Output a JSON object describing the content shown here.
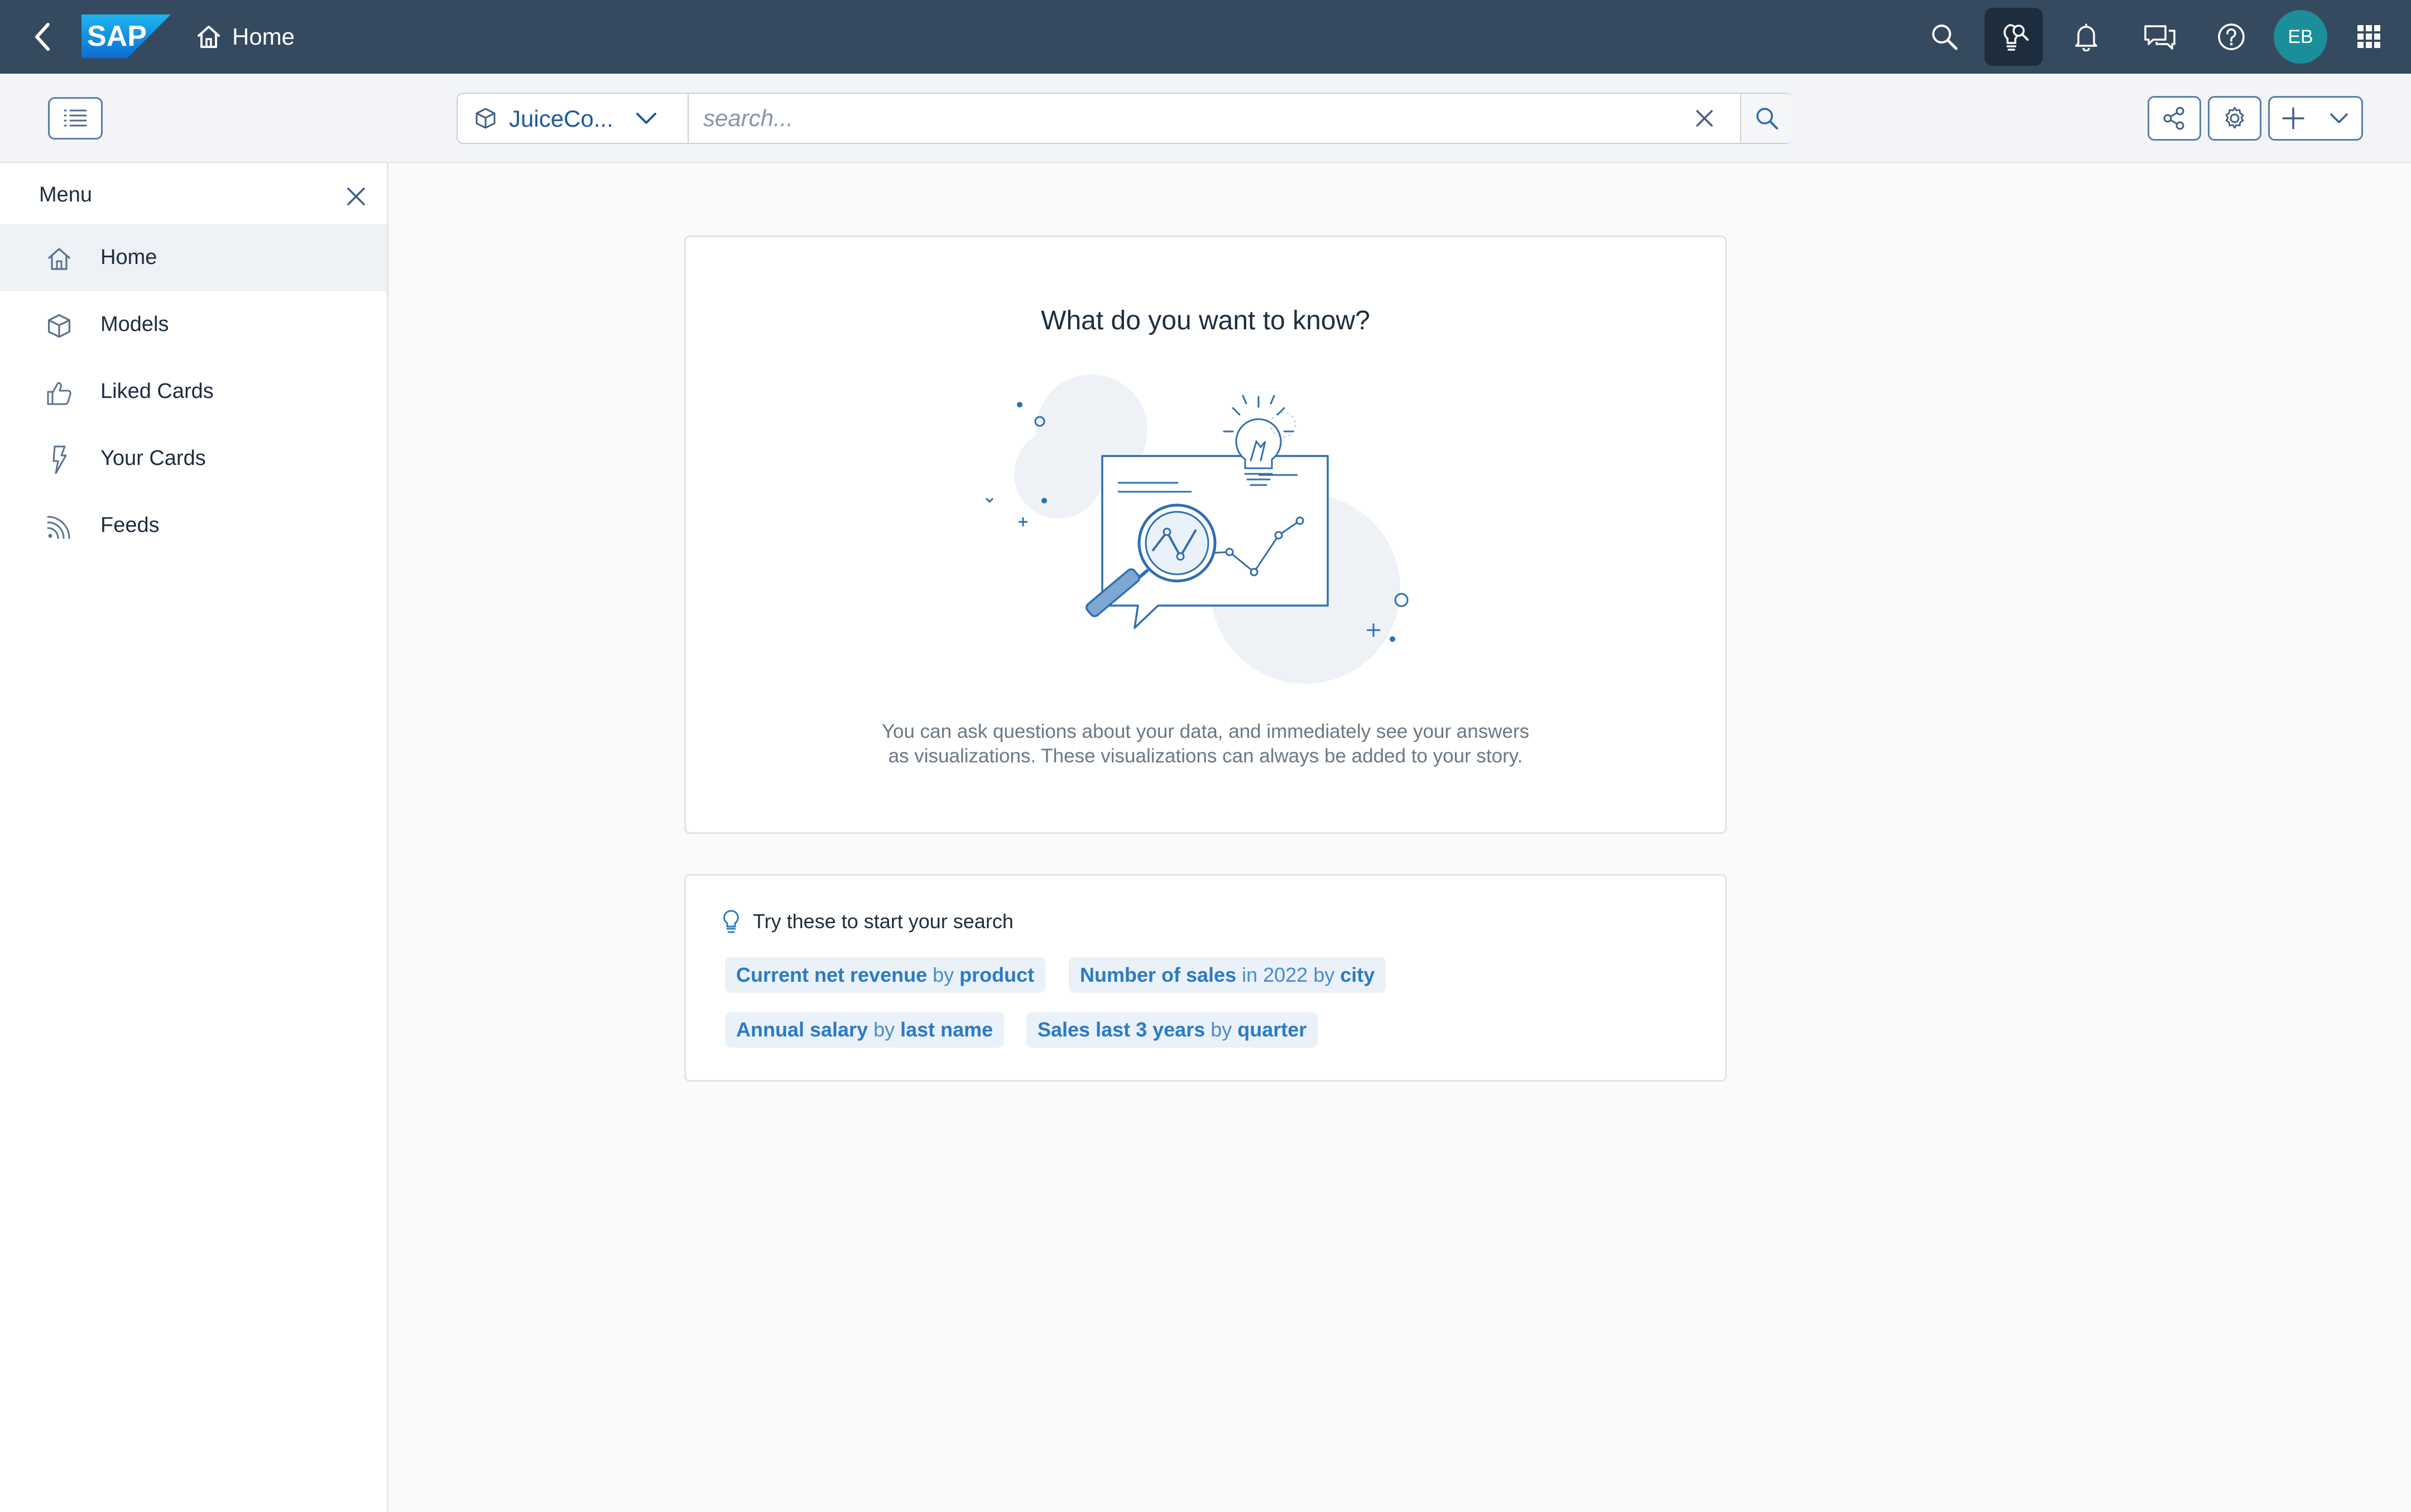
{
  "shellbar": {
    "logo_text": "SAP",
    "home_label": "Home",
    "avatar_initials": "EB",
    "icons": [
      "back-icon",
      "home-icon",
      "search-icon",
      "insight-icon",
      "bell-icon",
      "chat-icon",
      "help-icon",
      "app-grid-icon"
    ]
  },
  "toolbar": {
    "model_name": "JuiceCo...",
    "search_placeholder": "search...",
    "icons": [
      "menu-list-icon",
      "cube-icon",
      "chevron-down-icon",
      "clear-icon",
      "search-icon",
      "share-icon",
      "gear-icon",
      "plus-icon",
      "chevron-down-icon"
    ]
  },
  "menu": {
    "title": "Menu",
    "items": [
      {
        "label": "Home",
        "icon": "home-icon",
        "active": true
      },
      {
        "label": "Models",
        "icon": "cube-icon",
        "active": false
      },
      {
        "label": "Liked Cards",
        "icon": "thumbs-up-icon",
        "active": false
      },
      {
        "label": "Your Cards",
        "icon": "lightning-icon",
        "active": false
      },
      {
        "label": "Feeds",
        "icon": "rss-icon",
        "active": false
      }
    ]
  },
  "hero": {
    "title": "What do you want to know?",
    "description_line1": "You can ask questions about your data, and immediately see your answers",
    "description_line2": "as visualizations. These visualizations can always be added to your story."
  },
  "suggestions": {
    "heading": "Try these to start your search",
    "chips": [
      {
        "parts": [
          {
            "t": "Current net revenue",
            "b": true
          },
          {
            "t": " by ",
            "b": false
          },
          {
            "t": "product",
            "b": true
          }
        ]
      },
      {
        "parts": [
          {
            "t": "Number of sales",
            "b": true
          },
          {
            "t": " in 2022 by ",
            "b": false
          },
          {
            "t": "city",
            "b": true
          }
        ]
      },
      {
        "parts": [
          {
            "t": "Annual salary",
            "b": true
          },
          {
            "t": " by ",
            "b": false
          },
          {
            "t": "last name",
            "b": true
          }
        ]
      },
      {
        "parts": [
          {
            "t": "Sales last 3 years",
            "b": true
          },
          {
            "t": " by ",
            "b": false
          },
          {
            "t": "quarter",
            "b": true
          }
        ]
      }
    ]
  },
  "colors": {
    "shell": "#354a5f",
    "accent": "#0a6ed1",
    "avatar": "#1a8f99",
    "chip_bg": "#eaf1f8"
  }
}
